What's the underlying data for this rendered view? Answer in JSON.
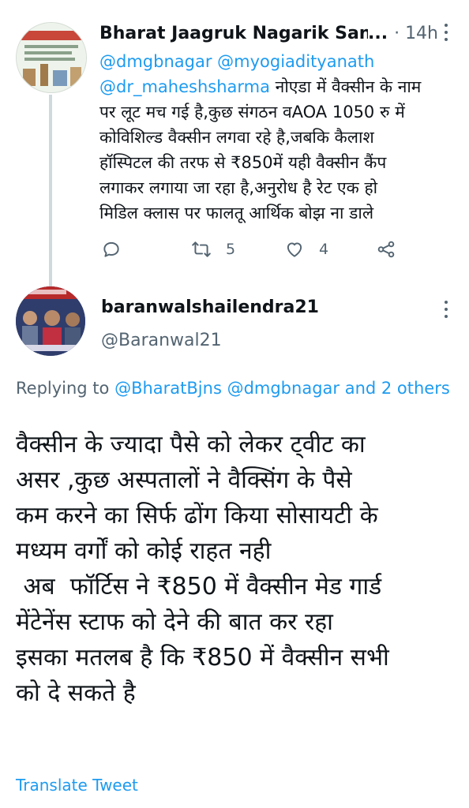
{
  "tweet1": {
    "author_name": "Bharat Jaagruk Nagarik Sang",
    "ellipsis": "...",
    "time": "· 14h",
    "body_lines": [
      {
        "mentions": "@dmgbnagar @myogiadityanath",
        "text": ""
      },
      {
        "mentions": "@dr_maheshsharma",
        "text": " नोएडा में वैक्सीन के नाम"
      },
      {
        "mentions": "",
        "text": "पर लूट मच गई है,कुछ संगठन वAOA 1050 रु में"
      },
      {
        "mentions": "",
        "text": "कोविशिल्ड वैक्सीन लगवा रहे है,जबकि कैलाश"
      },
      {
        "mentions": "",
        "text": "हॉस्पिटल की तरफ से ₹850में यही वैक्सीन कैंप"
      },
      {
        "mentions": "",
        "text": "लगाकर लगाया जा रहा है,अनुरोध है रेट एक हो"
      },
      {
        "mentions": "",
        "text": "मिडिल क्लास पर फालतू आर्थिक बोझ ना डाले"
      }
    ],
    "actions": {
      "reply": {
        "icon": "reply-icon",
        "count": ""
      },
      "retweet": {
        "icon": "retweet-icon",
        "count": "5"
      },
      "like": {
        "icon": "heart-icon",
        "count": "4"
      },
      "share": {
        "icon": "share-icon",
        "count": ""
      }
    }
  },
  "tweet2": {
    "author_name": "baranwalshailendra21",
    "handle": "@Baranwal21",
    "replying_prefix": "Replying to ",
    "replying_mentions": "@BharatBjns @dmgbnagar and 2 others",
    "body": "वैक्सीन के ज्यादा पैसे को लेकर ट्वीट का\nअसर ,कुछ अस्पतालों ने वैक्सिंग के पैसे\nकम करने का सिर्फ ढोंग किया सोसायटी के\nमध्यम वर्गों को कोई राहत नही\n अब  फॉर्टिस ने ₹850 में वैक्सीन मेड गार्ड\nमेंटेनेंस स्टाफ को देने की बात कर रहा\nइसका मतलब है कि ₹850 में वैक्सीन सभी\nको दे सकते है",
    "translate_label": "Translate Tweet"
  },
  "colors": {
    "link": "#1d9bf0",
    "secondary_text": "#536471",
    "primary_text": "#0f1419",
    "thread_line": "#cfd9de"
  }
}
